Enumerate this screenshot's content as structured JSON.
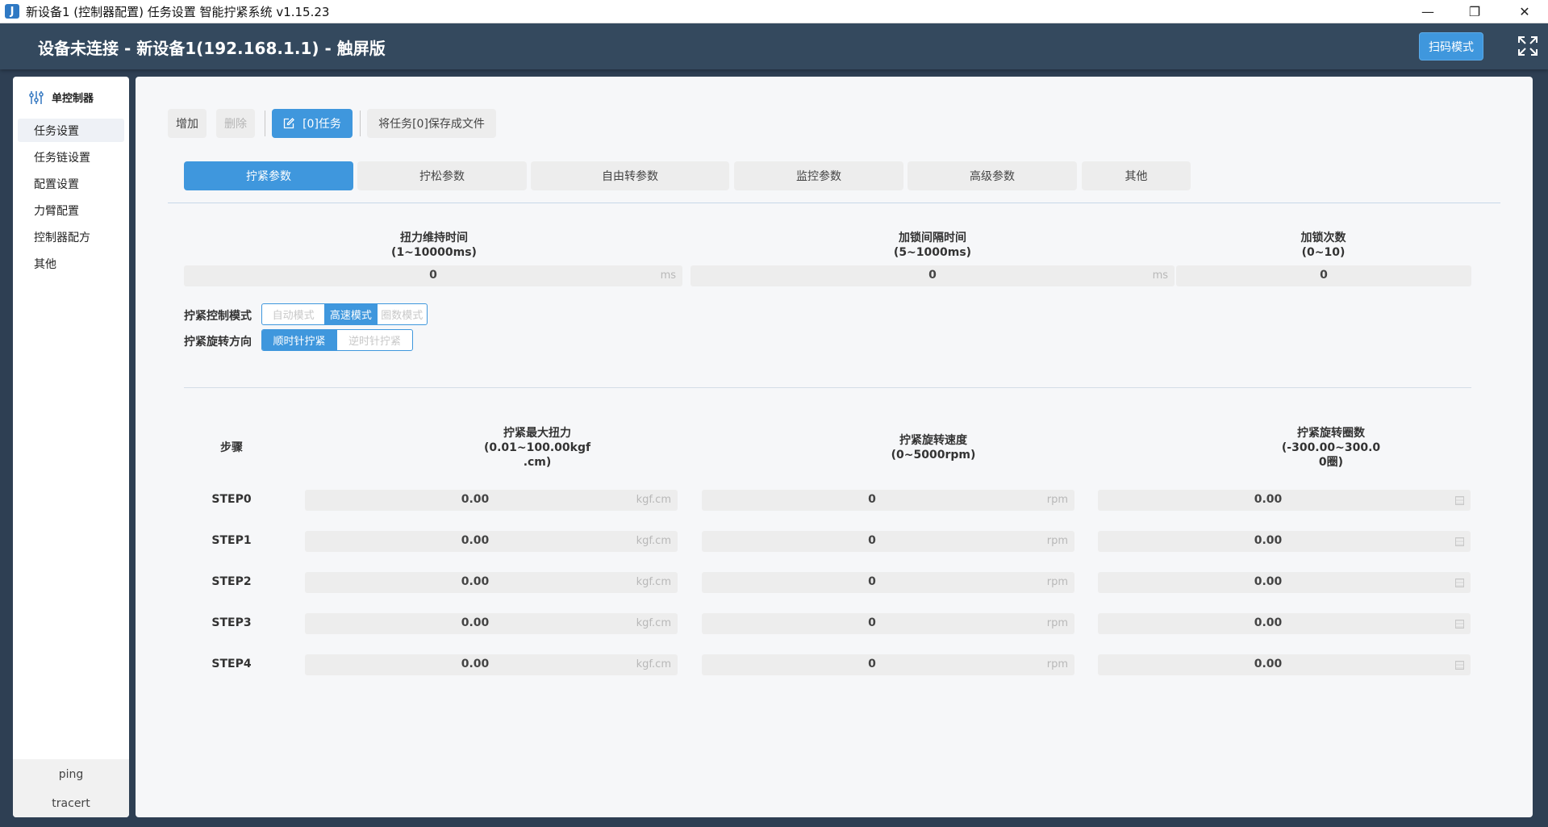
{
  "window": {
    "title": "新设备1 (控制器配置) 任务设置 智能拧紧系统 v1.15.23",
    "icon_glyph": "J",
    "minimize_glyph": "—",
    "restore_glyph": "❐",
    "close_glyph": "✕"
  },
  "header": {
    "title": "设备未连接 - 新设备1(192.168.1.1) - 触屏版",
    "scan_button": "扫码模式",
    "fullscreen_icon": "fullscreen-icon"
  },
  "sidebar": {
    "title": "单控制器",
    "title_icon": "sliders-icon",
    "items": [
      {
        "label": "任务设置",
        "active": true
      },
      {
        "label": "任务链设置",
        "active": false
      },
      {
        "label": "配置设置",
        "active": false
      },
      {
        "label": "力臂配置",
        "active": false
      },
      {
        "label": "控制器配方",
        "active": false
      },
      {
        "label": "其他",
        "active": false
      }
    ],
    "footer": {
      "ping": "ping",
      "tracert": "tracert"
    }
  },
  "toolbar": {
    "add": "增加",
    "delete": "删除",
    "task": "[0]任务",
    "task_icon": "edit-icon",
    "save_file": "将任务[0]保存成文件"
  },
  "tabs": [
    {
      "label": "拧紧参数",
      "active": true
    },
    {
      "label": "拧松参数",
      "active": false
    },
    {
      "label": "自由转参数",
      "active": false
    },
    {
      "label": "监控参数",
      "active": false
    },
    {
      "label": "高级参数",
      "active": false
    },
    {
      "label": "其他",
      "active": false
    }
  ],
  "params": [
    {
      "label": "扭力维持时间",
      "range": "(1~10000ms)",
      "value": "0",
      "unit": "ms"
    },
    {
      "label": "加锁间隔时间",
      "range": "(5~1000ms)",
      "value": "0",
      "unit": "ms"
    },
    {
      "label": "加锁次数",
      "range": "(0~10)",
      "value": "0",
      "unit": ""
    }
  ],
  "control_mode": {
    "label": "拧紧控制模式",
    "options": [
      "自动模式",
      "高速模式",
      "圈数模式"
    ],
    "selected": "高速模式"
  },
  "direction": {
    "label": "拧紧旋转方向",
    "options": [
      "顺时针拧紧",
      "逆时针拧紧"
    ],
    "selected": "顺时针拧紧"
  },
  "steps_table": {
    "col_step": "步骤",
    "col_torque": [
      "拧紧最大扭力",
      "(0.01~100.00kgf",
      ".cm)"
    ],
    "col_speed": [
      "拧紧旋转速度",
      "(0~5000rpm)"
    ],
    "col_turns": [
      "拧紧旋转圈数",
      "(-300.00~300.0",
      "0圈)"
    ],
    "torque_unit": "kgf.cm",
    "speed_unit": "rpm",
    "turns_unit_icon": "turns-unit-icon",
    "rows": [
      {
        "step": "STEP0",
        "torque": "0.00",
        "speed": "0",
        "turns": "0.00"
      },
      {
        "step": "STEP1",
        "torque": "0.00",
        "speed": "0",
        "turns": "0.00"
      },
      {
        "step": "STEP2",
        "torque": "0.00",
        "speed": "0",
        "turns": "0.00"
      },
      {
        "step": "STEP3",
        "torque": "0.00",
        "speed": "0",
        "turns": "0.00"
      },
      {
        "step": "STEP4",
        "torque": "0.00",
        "speed": "0",
        "turns": "0.00"
      }
    ]
  }
}
